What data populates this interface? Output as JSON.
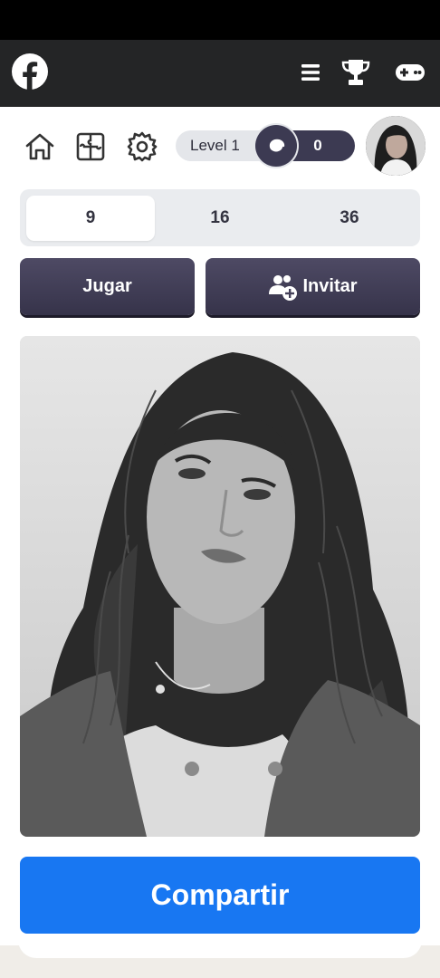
{
  "app": {
    "logo_icon": "facebook-logo",
    "accent": "#1877f2",
    "topbar_color": "#242526"
  },
  "topbar": {
    "icons": [
      "menu-icon",
      "trophy-icon",
      "gamepad-icon"
    ]
  },
  "toolbar": {
    "icons": [
      "home-icon",
      "puzzle-icon",
      "gear-icon",
      "spiral-icon"
    ],
    "level_label": "Level 1",
    "score": "0"
  },
  "grid_options": [
    {
      "label": "9",
      "selected": true
    },
    {
      "label": "16",
      "selected": false
    },
    {
      "label": "36",
      "selected": false
    }
  ],
  "actions": {
    "play_label": "Jugar",
    "invite_label": "Invitar"
  },
  "share": {
    "label": "Compartir"
  }
}
